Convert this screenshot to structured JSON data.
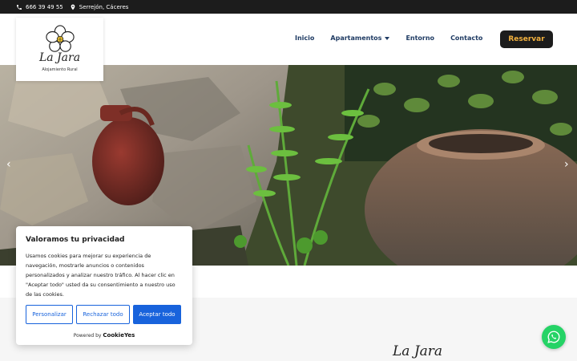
{
  "topbar": {
    "phone": "666 39 49 55",
    "location": "Serrejón, Cáceres",
    "phone_icon": "phone-icon",
    "location_icon": "map-pin-icon"
  },
  "logo": {
    "name": "La Jara",
    "subtitle": "Alojamiento Rural"
  },
  "nav": {
    "items": [
      "Inicio",
      "Apartamentos",
      "Entorno",
      "Contacto"
    ]
  },
  "header": {
    "reserve_label": "Reservar"
  },
  "hero": {
    "prev_label": "‹",
    "next_label": "›"
  },
  "cookie": {
    "title": "Valoramos tu privacidad",
    "text": "Usamos cookies para mejorar su experiencia de navegación, mostrarle anuncios o contenidos personalizados y analizar nuestro tráfico. Al hacer clic en \"Aceptar todo\" usted da su consentimiento a nuestro uso de las cookies.",
    "customize": "Personalizar",
    "reject": "Rechazar todo",
    "accept": "Aceptar todo",
    "powered": "Powered by",
    "brand": "CookieYes"
  },
  "footer": {
    "logo": "La Jara"
  },
  "colors": {
    "accent": "#1f3b63",
    "button_text": "#f2b13e",
    "cookie_blue": "#1863dc",
    "whatsapp": "#25d366"
  }
}
